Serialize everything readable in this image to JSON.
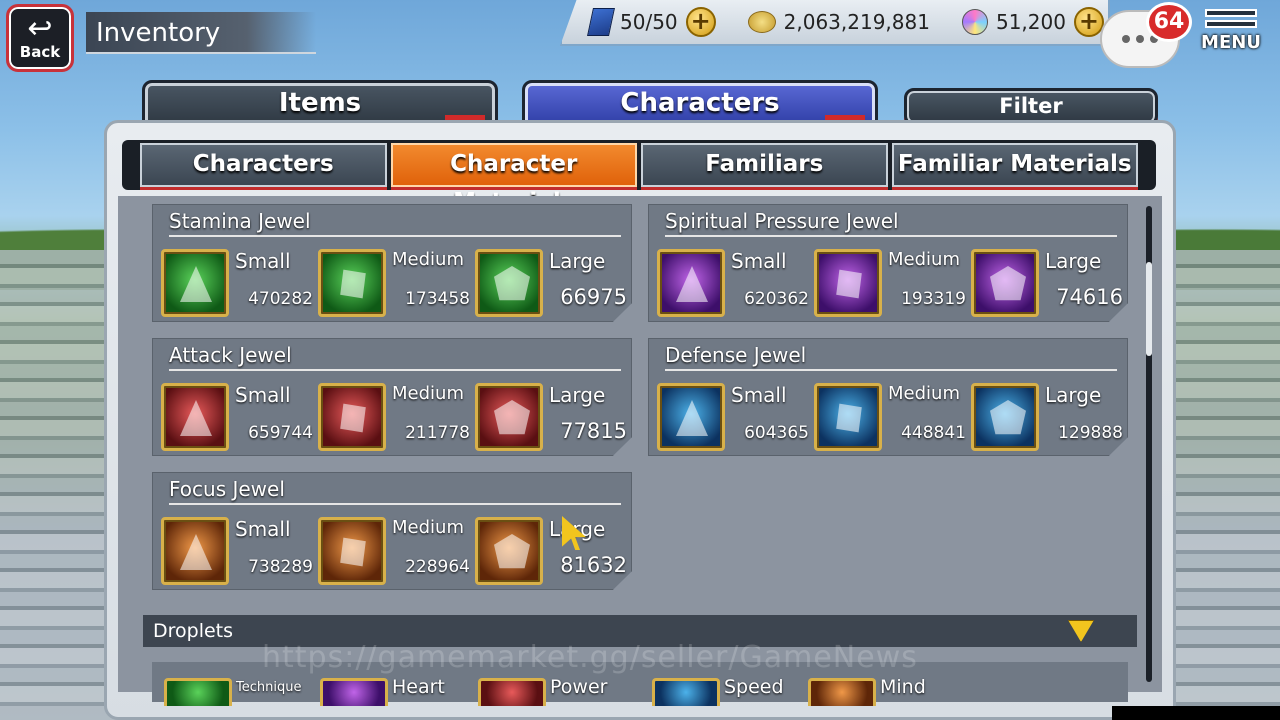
{
  "header": {
    "back_label": "Back",
    "title": "Inventory",
    "stamina": "50/50",
    "coins": "2,063,219,881",
    "orbs": "51,200",
    "notifications": "64",
    "menu_label": "MENU"
  },
  "tabs": {
    "items_label": "Items",
    "characters_label": "Characters",
    "filter_label": "Filter"
  },
  "subtabs": [
    {
      "label": "Characters",
      "active": false
    },
    {
      "label": "Character Materials",
      "active": true
    },
    {
      "label": "Familiars",
      "active": false
    },
    {
      "label": "Familiar Materials",
      "active": false
    }
  ],
  "groups": [
    {
      "title": "Stamina Jewel",
      "color": "green",
      "items": [
        {
          "size": "Small",
          "qty": "470282"
        },
        {
          "size": "Medium",
          "qty": "173458"
        },
        {
          "size": "Large",
          "qty": "66975"
        }
      ]
    },
    {
      "title": "Spiritual Pressure Jewel",
      "color": "purple",
      "items": [
        {
          "size": "Small",
          "qty": "620362"
        },
        {
          "size": "Medium",
          "qty": "193319"
        },
        {
          "size": "Large",
          "qty": "74616"
        }
      ]
    },
    {
      "title": "Attack Jewel",
      "color": "red",
      "items": [
        {
          "size": "Small",
          "qty": "659744"
        },
        {
          "size": "Medium",
          "qty": "211778"
        },
        {
          "size": "Large",
          "qty": "77815"
        }
      ]
    },
    {
      "title": "Defense Jewel",
      "color": "blue",
      "items": [
        {
          "size": "Small",
          "qty": "604365"
        },
        {
          "size": "Medium",
          "qty": "448841"
        },
        {
          "size": "Large",
          "qty": "129888"
        }
      ]
    },
    {
      "title": "Focus Jewel",
      "color": "orange",
      "items": [
        {
          "size": "Small",
          "qty": "738289"
        },
        {
          "size": "Medium",
          "qty": "228964"
        },
        {
          "size": "Large",
          "qty": "81632"
        }
      ]
    }
  ],
  "droplets": {
    "label": "Droplets",
    "items": [
      {
        "label": "Technique",
        "color": "green"
      },
      {
        "label": "Heart",
        "color": "purple"
      },
      {
        "label": "Power",
        "color": "red"
      },
      {
        "label": "Speed",
        "color": "blue"
      },
      {
        "label": "Mind",
        "color": "orange"
      }
    ]
  },
  "watermark": "https://gamemarket.gg/seller/GameNews"
}
